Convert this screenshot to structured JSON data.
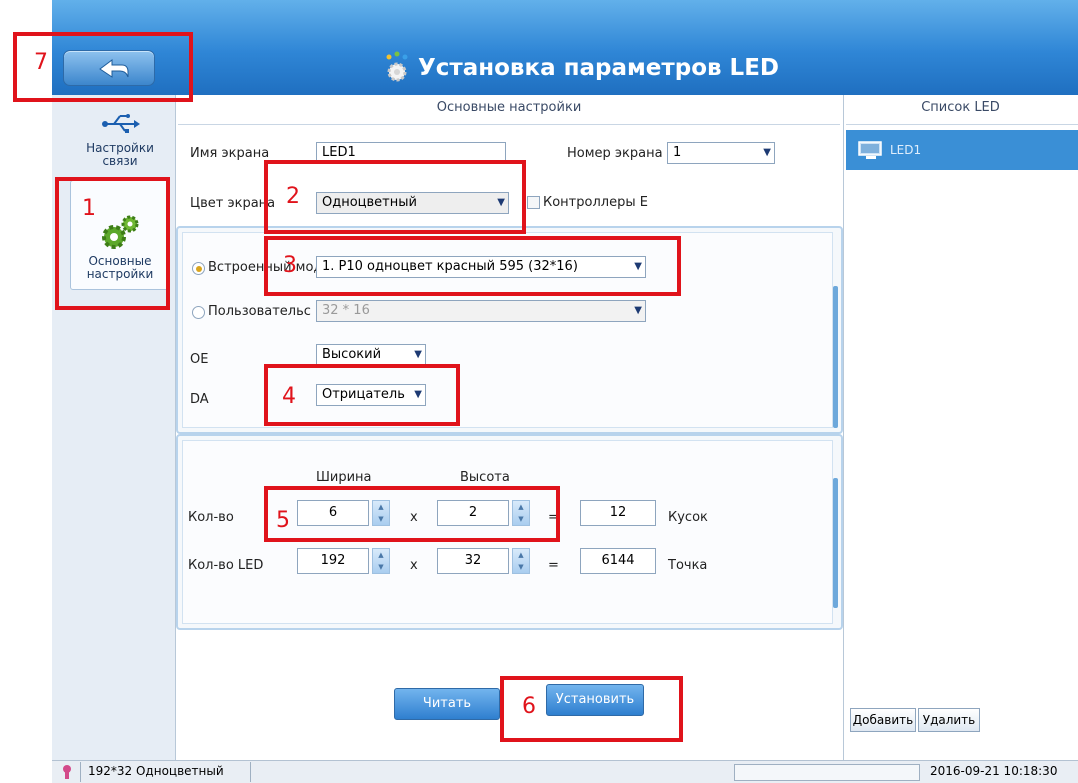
{
  "window": {
    "title": "Установка параметров LED",
    "back_icon": "back-arrow-icon"
  },
  "nav": {
    "items": [
      {
        "label_line1": "Настройки",
        "label_line2": "связи",
        "icon": "usb-icon"
      },
      {
        "label_line1": "Основные",
        "label_line2": "настройки",
        "icon": "gears-icon"
      }
    ]
  },
  "main": {
    "title": "Основные настройки",
    "screen_name_label": "Имя экрана",
    "screen_name_value": "LED1",
    "screen_number_label": "Номер экрана",
    "screen_number_value": "1",
    "screen_color_label": "Цвет экрана",
    "screen_color_value": "Одноцветный",
    "controllers_label": "Контроллеры E",
    "builtin_radio_label": "Встроенный мод",
    "builtin_module_value": "1. P10 одноцвет красный 595 (32*16)",
    "custom_radio_label": "Пользовательс",
    "custom_module_value": "32 * 16",
    "oe_label": "OE",
    "oe_value": "Высокий",
    "da_label": "DA",
    "da_value": "Отрицатель",
    "width_header": "Ширина",
    "height_header": "Высота",
    "count_label": "Кол-во",
    "count_width": "6",
    "count_height": "2",
    "count_total": "12",
    "count_unit": "Кусок",
    "led_label": "Кол-во LED",
    "led_width": "192",
    "led_height": "32",
    "led_total": "6144",
    "led_unit": "Точка",
    "times": "x",
    "equals": "=",
    "read_button": "Читать",
    "set_button": "Установить"
  },
  "right": {
    "title": "Список LED",
    "items": [
      "LED1"
    ],
    "add_button": "Добавить",
    "delete_button": "Удалить"
  },
  "status": {
    "screen_info": "192*32 Одноцветный",
    "datetime": "2016-09-21 10:18:30"
  },
  "annotations": [
    "1",
    "2",
    "3",
    "4",
    "5",
    "6",
    "7"
  ],
  "colors": {
    "header": "#2f86d6",
    "annotation": "#e0131b",
    "selected_item": "#3a8fd6"
  }
}
